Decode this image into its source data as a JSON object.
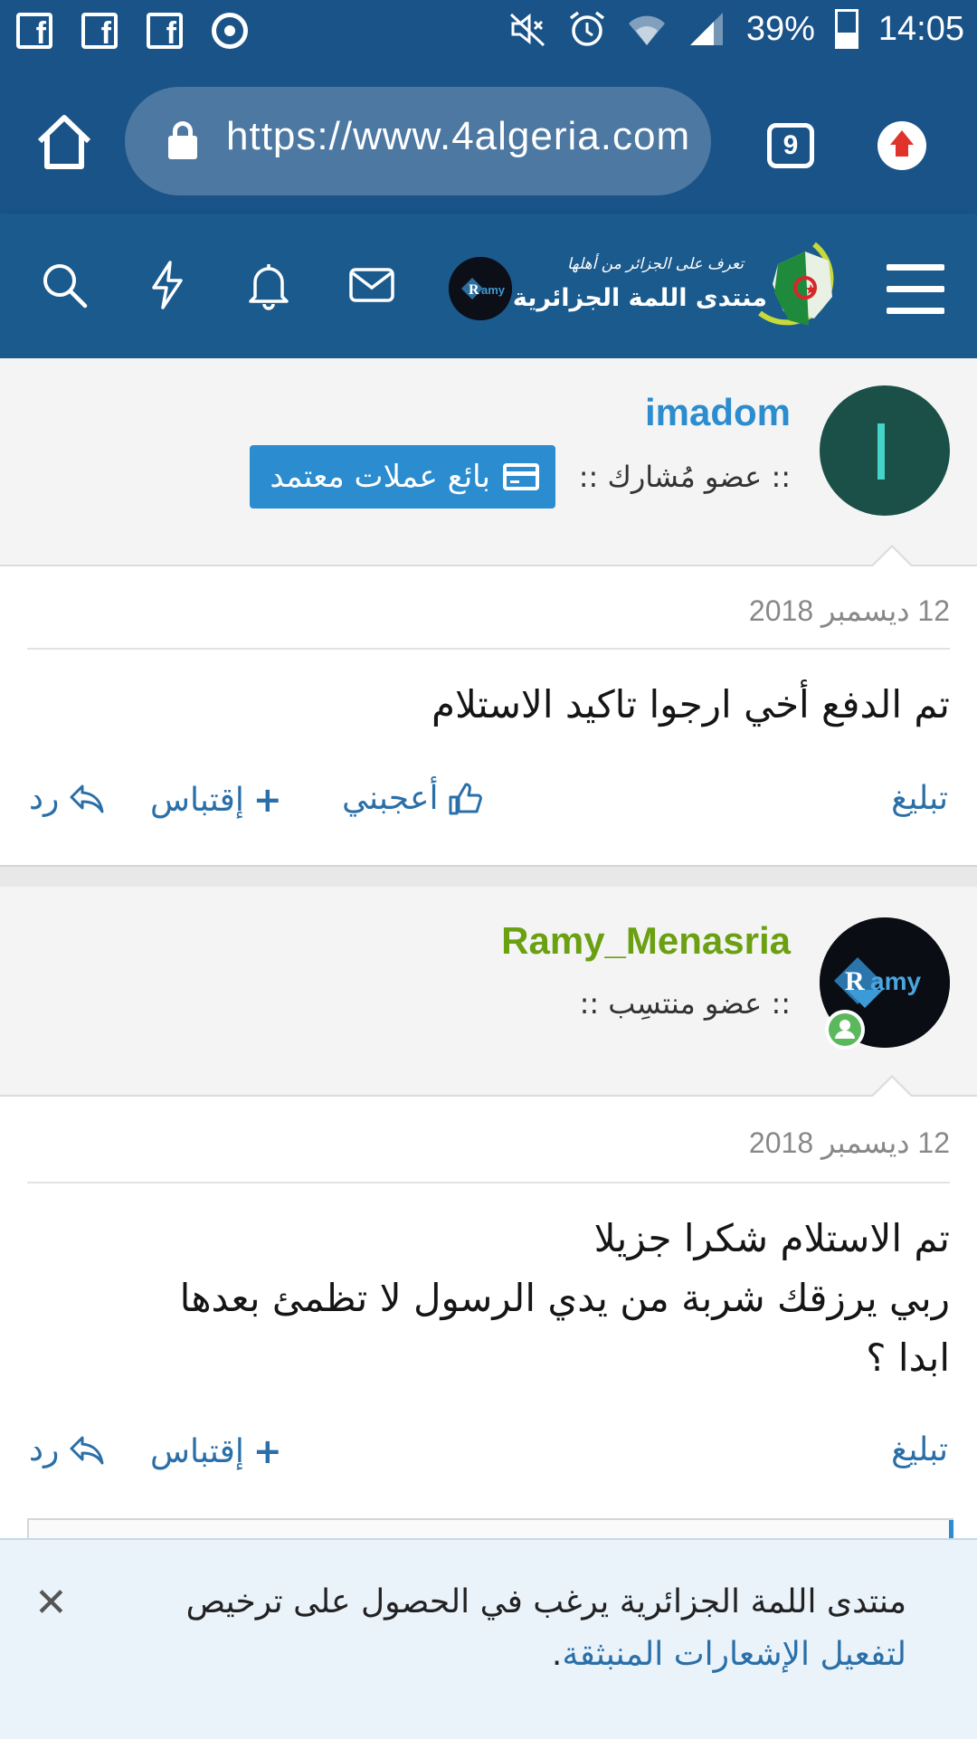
{
  "status_bar": {
    "fb_letters": [
      "f",
      "f",
      "f"
    ],
    "battery": "39%",
    "time": "14:05",
    "icons": [
      "facebook-icon",
      "facebook-icon",
      "facebook-icon",
      "chrome-icon",
      "mute-icon",
      "alarm-icon",
      "wifi-icon",
      "signal-icon",
      "battery-icon"
    ]
  },
  "browser": {
    "url": "https://www.4algeria.com",
    "tab_count": "9"
  },
  "site": {
    "logo_tagline": "تعرف على الجزائر من أهلها",
    "logo_name": "منتدى اللمة الجزائرية",
    "colors": {
      "header": "#1b5a8d",
      "link": "#2a6fa8",
      "badge": "#2b8ccf"
    }
  },
  "posts": [
    {
      "username": "imadom",
      "username_color": "#2b8ccf",
      "avatar_letter": "I",
      "member_title": ":: عضو مُشارك ::",
      "badge": "بائع عملات معتمد",
      "date": "12 ديسمبر 2018",
      "body": [
        "تم الدفع أخي ارجوا تاكيد الاستلام"
      ],
      "actions": {
        "report": "تبليغ",
        "like": "أعجبني",
        "quote": "إقتباس",
        "reply": "رد"
      }
    },
    {
      "username": "Ramy_Menasria",
      "username_color": "#6aa012",
      "avatar_text": "Ramy",
      "member_title": ":: عضو منتسِب ::",
      "date": "12 ديسمبر 2018",
      "body": [
        "تم الاستلام شكرا جزيلا",
        "ربي يرزقك شربة من يدي الرسول لا تظمئ بعدها",
        "ابدا ؟"
      ],
      "actions": {
        "report": "تبليغ",
        "quote": "إقتباس",
        "reply": "رد"
      }
    }
  ],
  "notice": {
    "text": "منتدى اللمة الجزائرية يرغب في الحصول على ترخيص",
    "link": "لتفعيل الإشعارات المنبثقة",
    "period": "."
  }
}
